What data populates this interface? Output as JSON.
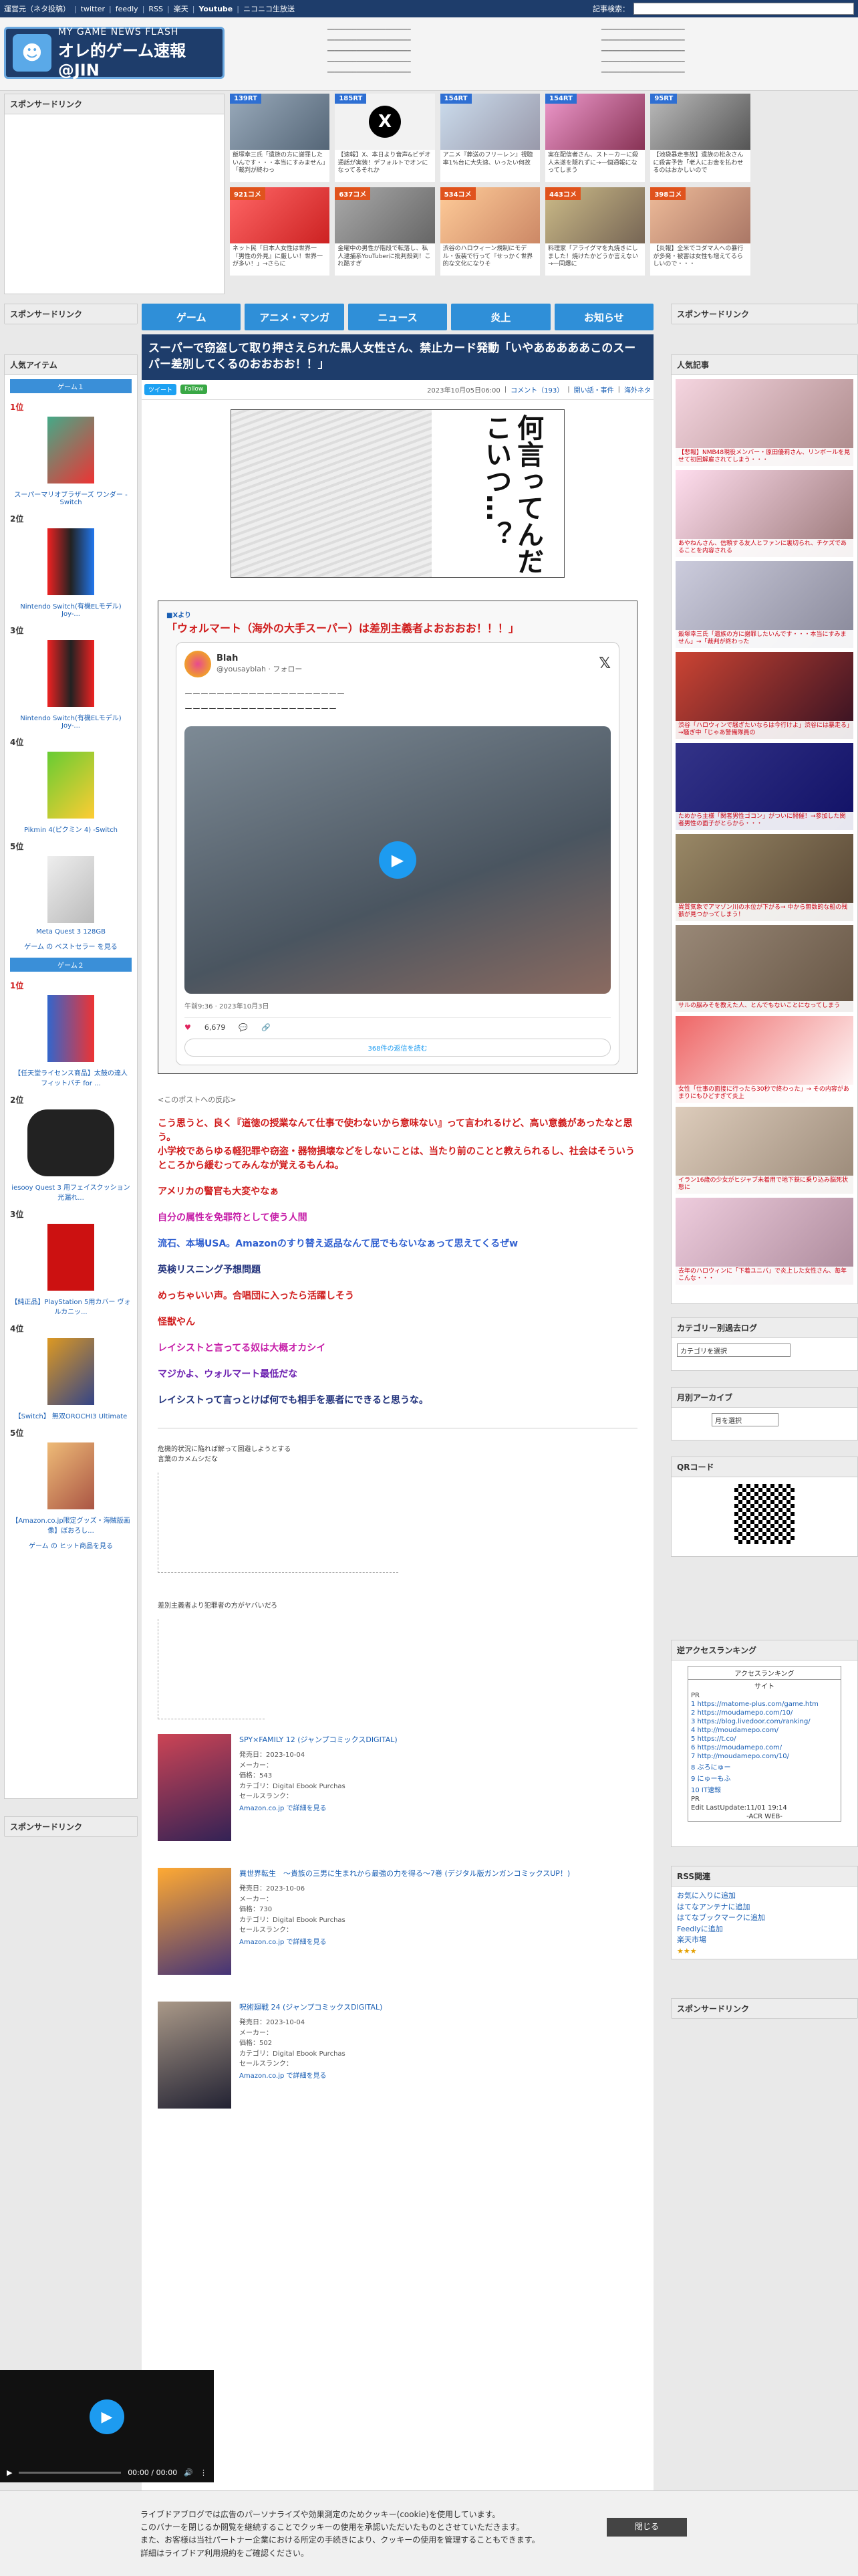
{
  "topbar": {
    "links": [
      "運営元（ネタ投稿）",
      "twitter",
      "feedly",
      "RSS",
      "楽天",
      "Youtube",
      "ニコニコ生放送"
    ],
    "search_label": "記事検索："
  },
  "header": {
    "logo_line1": "MY GAME NEWS FLASH",
    "logo_line2": "オレ的ゲーム速報@JIN"
  },
  "colors": {
    "nav": "#2f8fd8",
    "title_bg": "#1e3d6b",
    "accent_red": "#d01c1c"
  },
  "thumbs": [
    {
      "rt": "139RT",
      "cap": "飯塚幸三氏「遺族の方に謝罪したいんです・・・本当にすみません」「裁判が終わっ"
    },
    {
      "rt": "185RT",
      "cap": "【速報】X、本日より音声&ビデオ通話が実装！デフォルトでオンになってるそれか"
    },
    {
      "rt": "154RT",
      "cap": "アニメ『葬送のフリーレン』視聴率1%台に大失速、いったい何故"
    },
    {
      "rt": "154RT",
      "cap": "実在配信者さん、ストーカーに殺人未遂を隠れずに→一個通報になってしまう"
    },
    {
      "rt": "95RT",
      "cap": "【池袋暴走事故】遺族の松永さんに殺害予告「老人にお金を払わせるのはおかしいので"
    },
    {
      "rt": "921コメ",
      "cap": "ネット民「日本人女性は世界一『男性の外見』に厳しい！世界一が多い！」→さらに"
    },
    {
      "rt": "637コメ",
      "cap": "金曜中の男性が階段で転落し、私人逮捕系YouTuberに批判殺到！これ酷すぎ"
    },
    {
      "rt": "534コメ",
      "cap": "渋谷のハロウィーン規制にモデル・仮装で行って『せっかく世界的な文化になりそ"
    },
    {
      "rt": "443コメ",
      "cap": "料理家「アライグマを丸焼きにしました！焼けたかどうか言えない→一同爆に"
    },
    {
      "rt": "398コメ",
      "cap": "【炎報】全米でコダマ人への暴行が多発・被害は女性も増えてるらしいので・・・"
    }
  ],
  "left_sidebar": {
    "sponsor_head": "スポンサードリンク",
    "popular_head": "人気アイテム",
    "game1_btn": "ゲーム１",
    "game1": [
      {
        "rank": "1位",
        "name": "スーパーマリオブラザーズ ワンダー -Switch"
      },
      {
        "rank": "2位",
        "name": "Nintendo Switch(有機ELモデル) Joy-..."
      },
      {
        "rank": "3位",
        "name": "Nintendo Switch(有機ELモデル) Joy-..."
      },
      {
        "rank": "4位",
        "name": "Pikmin 4(ピクミン 4) -Switch"
      },
      {
        "rank": "5位",
        "name": "Meta Quest 3 128GB"
      }
    ],
    "best_link": "ゲーム の ベストセラー を見る",
    "game2_btn": "ゲーム２",
    "game2": [
      {
        "rank": "1位",
        "name": "【任天堂ライセンス商品】太鼓の達人 フィットバチ for ..."
      },
      {
        "rank": "2位",
        "name": "iesooy Quest 3 用フェイスクッション 光漏れ..."
      },
      {
        "rank": "3位",
        "name": "【純正品】PlayStation 5用カバー ヴォルカニッ..."
      },
      {
        "rank": "4位",
        "name": "【Switch】 無双OROCHI3 Ultimate"
      },
      {
        "rank": "5位",
        "name": "【Amazon.co.jp限定グッズ・海賊版画像】ぼおろし..."
      }
    ],
    "hit_link": "ゲーム の ヒット商品を見る",
    "sponsor_head2": "スポンサードリンク"
  },
  "nav": [
    "ゲーム",
    "アニメ・マンガ",
    "ニュース",
    "炎上",
    "お知らせ"
  ],
  "article": {
    "title": "スーパーで窃盗して取り押さえられた黒人女性さん、禁止カード発動「いやあああああこのスーパー差別してくるのおおおお！！」",
    "tweet_btn": "ツイート",
    "follow_btn": "Follow",
    "date": "2023年10月05日06:00",
    "comments": "コメント（193）",
    "category": "開い話・事件",
    "category2": "海外ネタ",
    "manga_text": "何言ってんだこいつ…？",
    "quote_src": "■Xより",
    "quote_title": "「ウォルマート（海外の大手スーパー）は差別主義者よおおおお！！！」",
    "tweet": {
      "name": "Blah",
      "handle": "@yousayblah · フォロー",
      "line1": "ーーーーーーーーーーーーーーーーーーーー",
      "line2": "ーーーーーーーーーーーーーーーーーーー",
      "time": "午前9:36 · 2023年10月3日",
      "likes": "6,679",
      "more": "368件の返信を読む"
    },
    "reaction_label": "<このポストへの反応>",
    "reactions": [
      "こう思うと、良く『道徳の授業なんて仕事で使わないから意味ない』って言われるけど、高い意義があったなと思う。",
      "小学校であらゆる軽犯罪や窃盗・器物損壊などをしないことは、当たり前のことと教えられるし、社会はそういうところから緩むってみんなが覚えるもんね。",
      "アメリカの警官も大変やなぁ",
      "自分の属性を免罪符として使う人間",
      "流石、本場USA。Amazonのすり替え返品なんて屁でもないなぁって思えてくるぜw",
      "英検リスニング予想問題",
      "めっちゃいい声。合唱団に入ったら活躍しそう",
      "怪獣やん",
      "レイシストと言ってる奴は大概オカシイ",
      "マジかよ、ウォルマート最低だな",
      "レイシストって言っとけば何でも相手を悪者にできると思うな。"
    ],
    "aa1_label": "危機的状況に陥れば解って回避しようとする",
    "aa1_sub": "言葉のカメムシだな",
    "aa2_label": "差別主義者より犯罪者の方がヤバいだろ",
    "products": [
      {
        "title": "SPY×FAMILY 12 (ジャンプコミックスDIGITAL)",
        "date": "発売日：2023-10-04",
        "maker": "メーカー：",
        "price": "価格：543",
        "cat": "カテゴリ：Digital Ebook Purchas",
        "rank": "セールスランク：",
        "link": "Amazon.co.jp で詳細を見る"
      },
      {
        "title": "異世界転生　～貴族の三男に生まれから最強の力を得る～7巻 (デジタル版ガンガンコミックスUP！)",
        "date": "発売日：2023-10-06",
        "maker": "メーカー：",
        "price": "価格：730",
        "cat": "カテゴリ：Digital Ebook Purchas",
        "rank": "セールスランク：",
        "link": "Amazon.co.jp で詳細を見る"
      },
      {
        "title": "呪術廻戦 24 (ジャンプコミックスDIGITAL)",
        "date": "発売日：2023-10-04",
        "maker": "メーカー：",
        "price": "価格：502",
        "cat": "カテゴリ：Digital Ebook Purchas",
        "rank": "セールスランク：",
        "link": "Amazon.co.jp で詳細を見る"
      }
    ]
  },
  "right_sidebar": {
    "sponsor_head": "スポンサードリンク",
    "popular_head": "人気記事",
    "popular": [
      "【悲報】NMB48現役メンバー・原田優莉さん、リンボールを見せて初回解雇されてしまう・・・",
      "あやねんさん、信頼する友人とファンに裏切られ、チケズであることを内容される",
      "飯塚幸三氏「遺族の方に謝罪したいんです・・・本当にすみません」→「裁判が終わった",
      "渋谷「ハロウィンで騒ぎたいならは今行けよ」渋谷には暴走る」→騒ぎ中「じゃあ警備隊員の",
      "ためから主様「関者男性ゴコン」がついに開催！→参加した関者男性の面子がとらから・・・",
      "異質気象でアマゾン川の水位が下がる→ 中から無数的な船の残骸が見つかってしまう！",
      "サルの脳みそを教えた人、とんでもないことになってしまう",
      "女性「仕事の面接に行ったら30秒で終わった」→ その内容があまりにもひどすぎて炎上",
      "イラン16歳の少女がヒジャブ未着用で地下鉄に乗り込み脳死状態に",
      "去年のハロウィンに「下着ユニバ」で炎上した女性さん、毎年こんな・・・"
    ],
    "cat_head": "カテゴリー別過去ログ",
    "cat_select": "カテゴリを選択",
    "month_head": "月別アーカイブ",
    "month_select": "月を選択",
    "qr_head": "QRコード",
    "acr_head": "逆アクセスランキング",
    "acr_title": "アクセスランキング",
    "acr_site": "サイト",
    "acr_rows": [
      "PR",
      "1 https://matome-plus.com/game.htm",
      "2 https://moudamepo.com/10/",
      "3 https://blog.livedoor.com/ranking/",
      "4 http://moudamepo.com/",
      "5 https://t.co/",
      "6 https://moudamepo.com/",
      "7 http://moudamepo.com/10/",
      "8 ぶろにゅー",
      "9 にゅーもふ",
      "10 IT速報",
      "PR",
      "Edit LastUpdate:11/01 19:14",
      "-ACR WEB-"
    ],
    "rss_head": "RSS関連",
    "rss_links": [
      "お気に入りに追加",
      "はてなアンテナに追加",
      "はてなブックマークに追加",
      "Feedlyに追加",
      "楽天市場"
    ],
    "sponsor_head2": "スポンサードリンク"
  },
  "player": {
    "time": "00:00 / 00:00"
  },
  "cookie": {
    "line1": "ライブドアブログでは広告のパーソナライズや効果測定のためクッキー(cookie)を使用しています。",
    "line2": "このバナーを閉じるか閲覧を継続することでクッキーの使用を承認いただいたものとさせていただきます。",
    "line3": "また、お客様は当社パートナー企業における所定の手続きにより、クッキーの使用を管理することもできます。",
    "line4": "詳細はライブドア利用規約をご確認ください。",
    "close": "閉じる"
  }
}
